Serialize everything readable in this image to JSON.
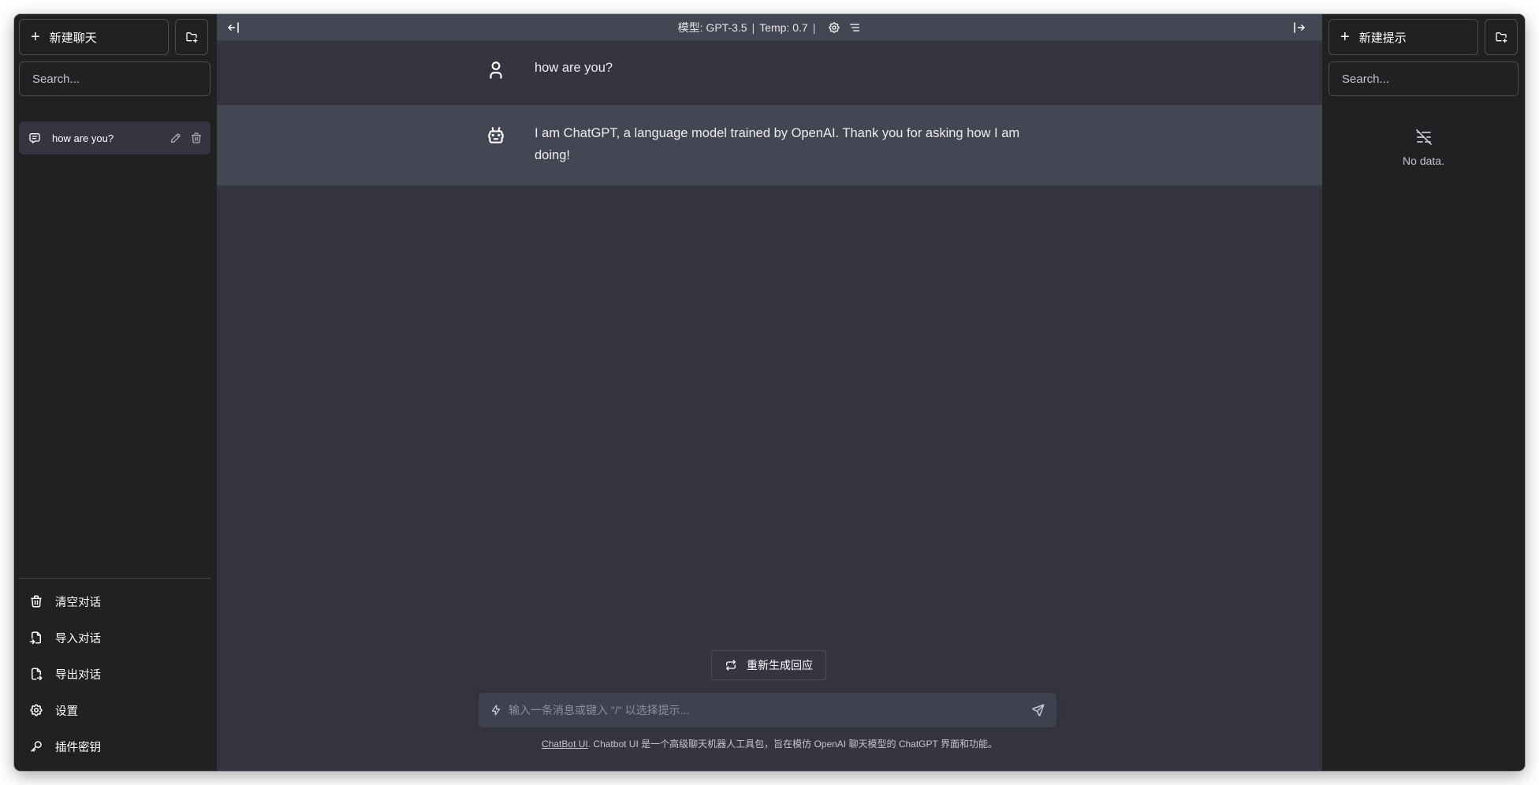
{
  "left_sidebar": {
    "new_chat_label": "新建聊天",
    "search_placeholder": "Search...",
    "conversations": [
      {
        "title": "how are you?"
      }
    ],
    "menu": {
      "clear": "清空对话",
      "import": "导入对话",
      "export": "导出对话",
      "settings": "设置",
      "plugin_keys": "插件密钥"
    }
  },
  "topbar": {
    "model": "模型: GPT-3.5",
    "temp": "Temp: 0.7",
    "separator": "|"
  },
  "messages": [
    {
      "role": "user",
      "text": "how are you?"
    },
    {
      "role": "assistant",
      "text": "I am ChatGPT, a language model trained by OpenAI. Thank you for asking how I am doing!"
    }
  ],
  "regenerate_label": "重新生成回应",
  "input": {
    "placeholder": "输入一条消息或键入 \"/\" 以选择提示..."
  },
  "footer": {
    "link_text": "ChatBot UI",
    "text": ". Chatbot UI 是一个高级聊天机器人工具包，旨在模仿 OpenAI 聊天模型的 ChatGPT 界面和功能。"
  },
  "right_sidebar": {
    "new_prompt_label": "新建提示",
    "search_placeholder": "Search...",
    "empty_text": "No data."
  },
  "colors": {
    "sidebar_bg": "#202123",
    "main_bg": "#343541",
    "assistant_row_bg": "#444654",
    "input_bg": "#40414f"
  }
}
